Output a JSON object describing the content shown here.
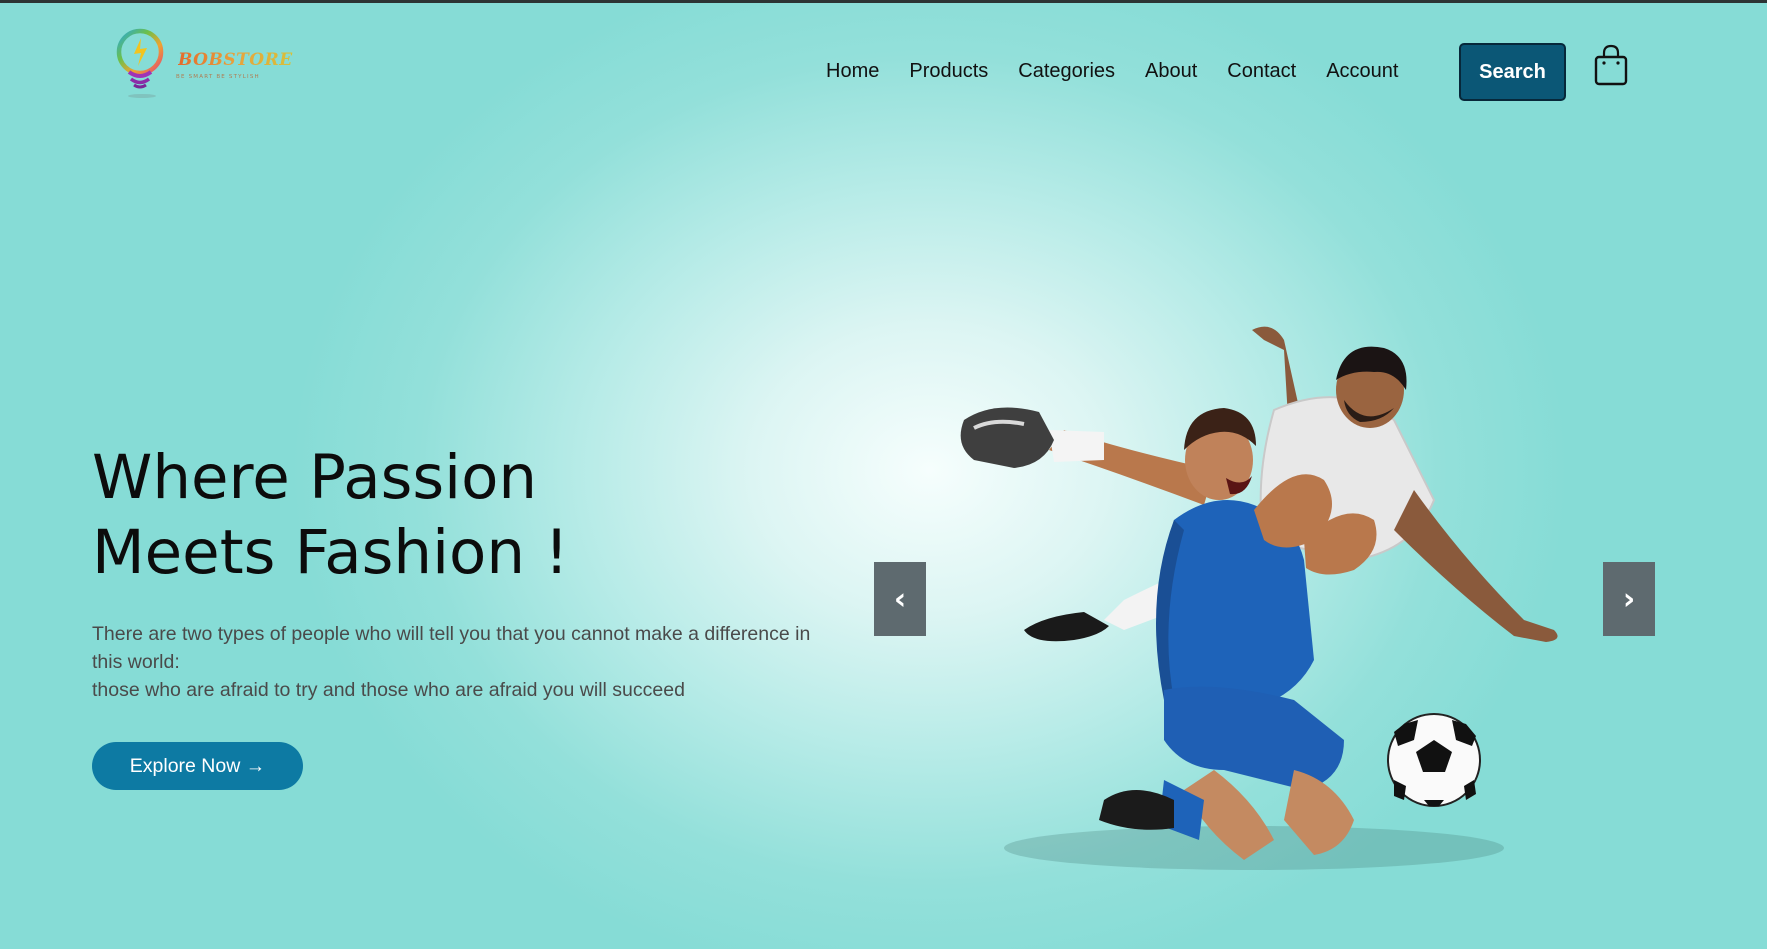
{
  "brand": {
    "name": "BOBSTORE",
    "tagline": "BE SMART BE STYLISH"
  },
  "nav": {
    "items": [
      "Home",
      "Products",
      "Categories",
      "About",
      "Contact",
      "Account"
    ],
    "search_label": "Search",
    "cart_icon": "shopping-bag-icon"
  },
  "hero": {
    "title_line1": "Where Passion",
    "title_line2": "Meets Fashion !",
    "desc_line1": "There are two types of people who will tell you that you cannot make a difference in",
    "desc_line2": "this world:",
    "desc_line3": "those who are afraid to try and those who are afraid you will succeed",
    "cta_label": "Explore Now →"
  },
  "carousel": {
    "prev_label": "‹",
    "next_label": "›",
    "image_alt": "soccer-players-illustration"
  },
  "colors": {
    "background": "#86dcd6",
    "search_button": "#0b5776",
    "cta_button": "#0d7aa3",
    "arrow_bg": "#5e6a6f"
  }
}
